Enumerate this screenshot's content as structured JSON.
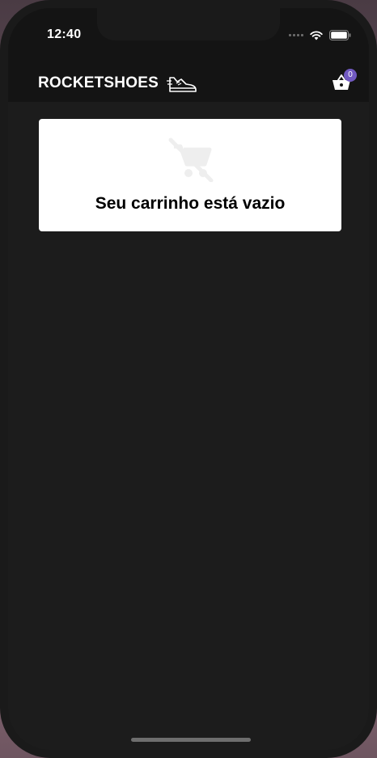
{
  "status_bar": {
    "time": "12:40"
  },
  "header": {
    "logo_text": "ROCKETSHOES",
    "logo_icon": "sneaker-icon",
    "cart_icon": "shopping-basket-icon",
    "cart_count": "0"
  },
  "cart": {
    "empty_icon": "remove-shopping-cart-icon",
    "empty_message": "Seu carrinho está vazio"
  },
  "colors": {
    "background": "#1c1c1c",
    "header": "#141414",
    "accent": "#7159c1",
    "card": "#ffffff",
    "empty_icon": "#eeeeee"
  }
}
